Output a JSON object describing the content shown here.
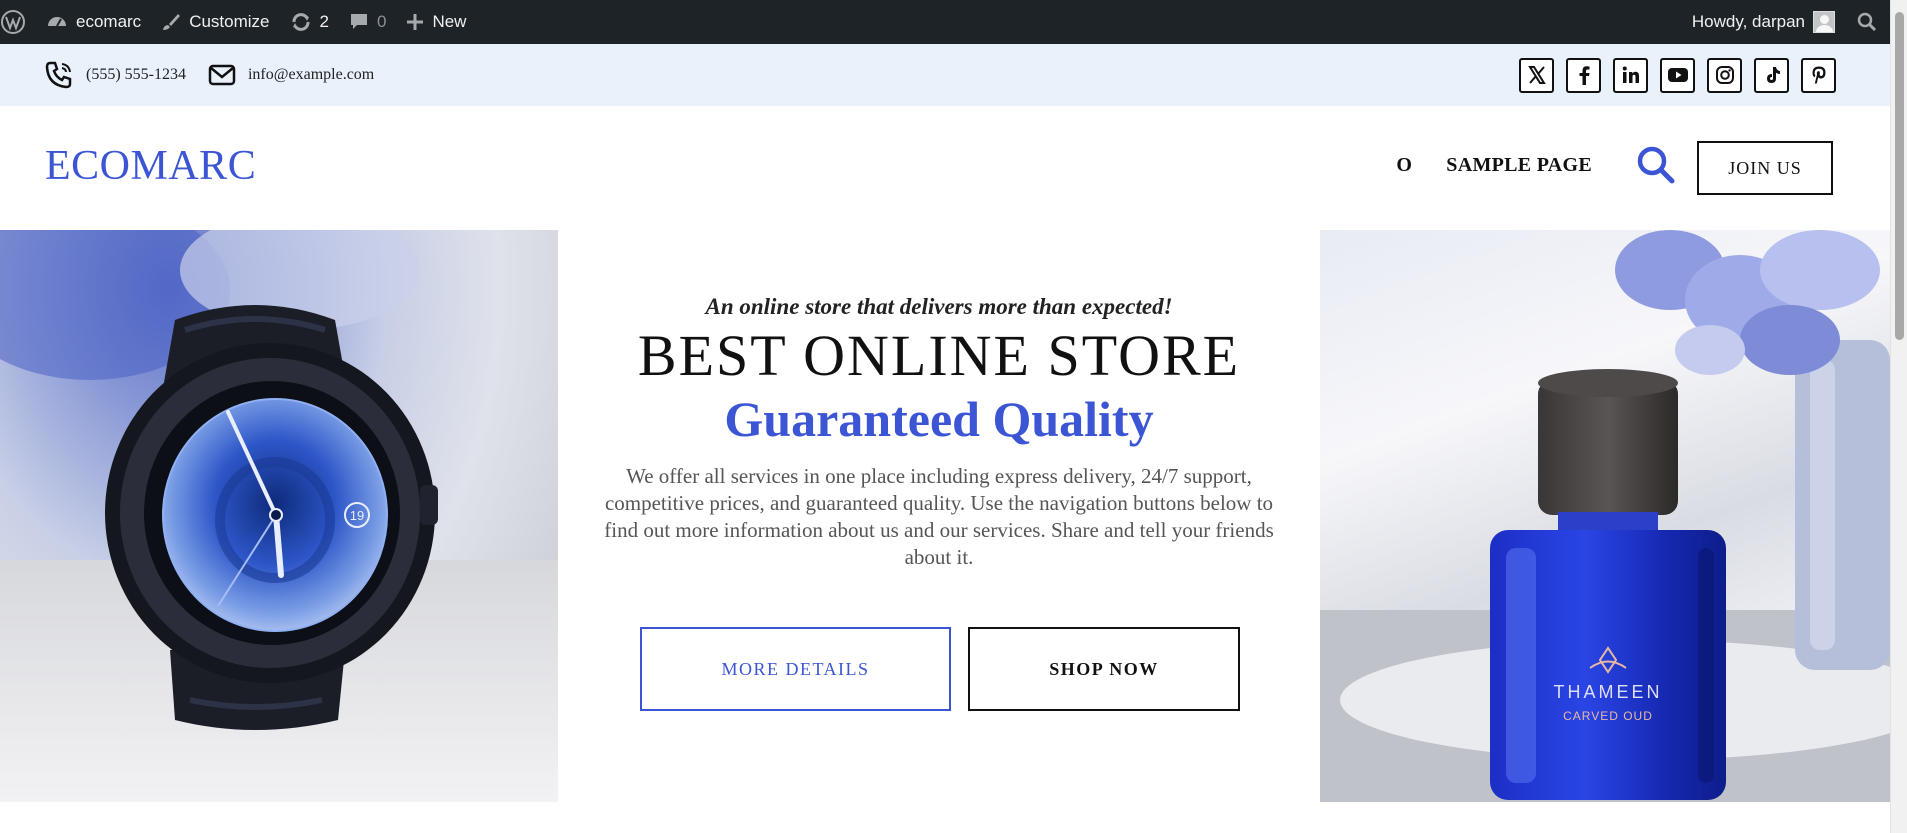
{
  "adminbar": {
    "site_name": "ecomarc",
    "customize": "Customize",
    "updates_count": "2",
    "comments_count": "0",
    "new_label": "New",
    "howdy": "Howdy, darpan"
  },
  "topbar": {
    "phone": "(555) 555-1234",
    "email": "info@example.com",
    "socials": [
      "x-icon",
      "facebook-icon",
      "linkedin-icon",
      "youtube-icon",
      "instagram-icon",
      "tiktok-icon",
      "pinterest-icon"
    ]
  },
  "header": {
    "logo": "ECOMARC",
    "nav": [
      "O",
      "SAMPLE PAGE"
    ],
    "join_label": "JOIN US"
  },
  "hero": {
    "tagline": "An online store that delivers more than expected!",
    "title_line1": "BEST ONLINE STORE",
    "title_line2": "Guaranteed Quality",
    "description": "We offer all services in one place including express delivery, 24/7 support, competitive prices, and guaranteed quality. Use the navigation buttons below to find out more information about us and our services. Share and tell your friends about it.",
    "more_label": "MORE DETAILS",
    "shop_label": "SHOP NOW",
    "watch_date": "19",
    "bottle_brand": "THAMEEN",
    "bottle_sub": "CARVED OUD"
  },
  "colors": {
    "accent": "#3b55d4",
    "adminbar_bg": "#1d2327",
    "topbar_bg": "#e9f1fb"
  }
}
